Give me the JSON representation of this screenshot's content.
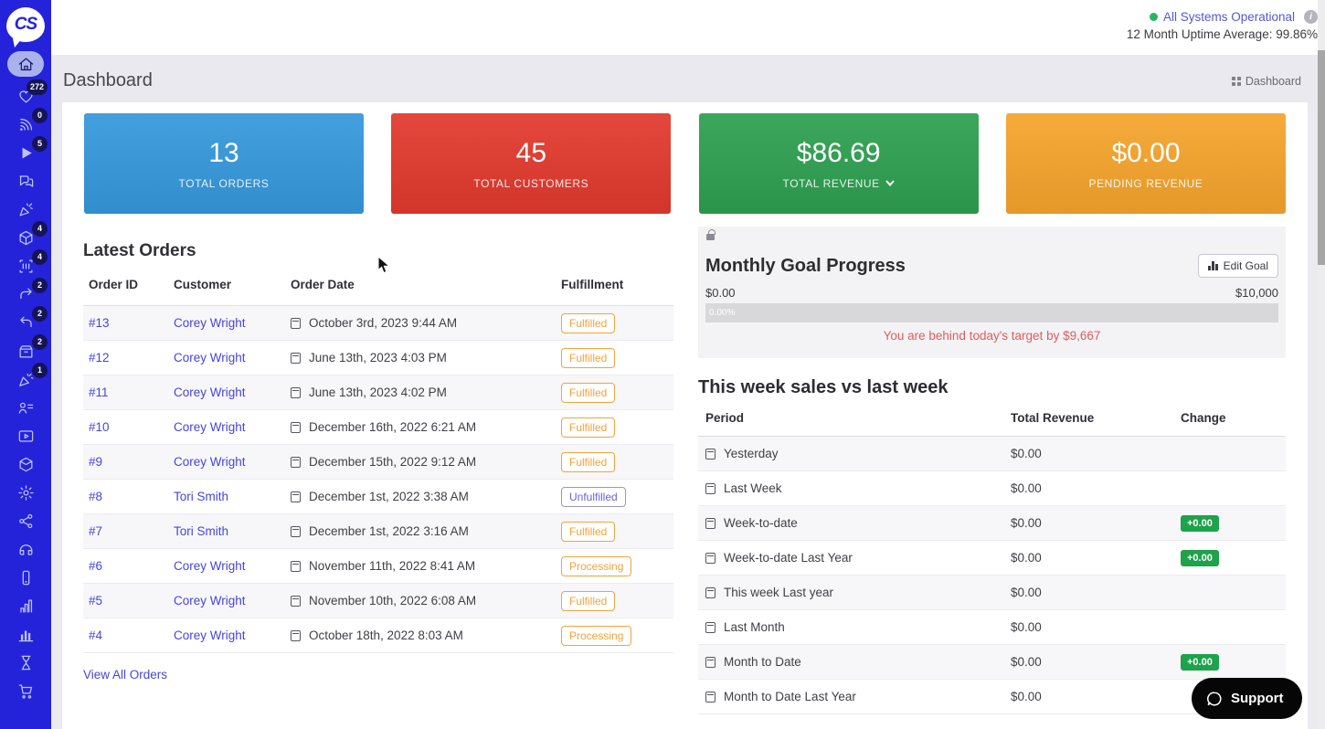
{
  "topbar": {
    "status_label": "All Systems Operational",
    "uptime_label": "12 Month Uptime Average: 99.86%",
    "info_glyph": "i"
  },
  "header": {
    "title": "Dashboard",
    "breadcrumb": "Dashboard"
  },
  "sidebar": {
    "logo": "CS",
    "items": [
      {
        "name": "dashboard-home",
        "badge": null
      },
      {
        "name": "favorites",
        "badge": "272"
      },
      {
        "name": "live-broadcast",
        "badge": "0"
      },
      {
        "name": "media-play",
        "badge": "5"
      },
      {
        "name": "messages",
        "badge": null
      },
      {
        "name": "promotions",
        "badge": null
      },
      {
        "name": "products",
        "badge": "4"
      },
      {
        "name": "inventory-scan",
        "badge": "4"
      },
      {
        "name": "orders-forward",
        "badge": "2"
      },
      {
        "name": "returns",
        "badge": "2"
      },
      {
        "name": "archive-box",
        "badge": "2"
      },
      {
        "name": "announcements",
        "badge": "1"
      },
      {
        "name": "customers",
        "badge": null
      },
      {
        "name": "video-library",
        "badge": null
      },
      {
        "name": "packages",
        "badge": null
      },
      {
        "name": "settings",
        "badge": null
      },
      {
        "name": "integrations",
        "badge": null
      },
      {
        "name": "support-headset",
        "badge": null
      },
      {
        "name": "mobile",
        "badge": null
      },
      {
        "name": "analytics",
        "badge": null
      },
      {
        "name": "reports",
        "badge": null
      },
      {
        "name": "history",
        "badge": null
      },
      {
        "name": "cart",
        "badge": null
      }
    ]
  },
  "stat_cards": [
    {
      "value": "13",
      "label": "TOTAL ORDERS",
      "color": "#3598db"
    },
    {
      "value": "45",
      "label": "TOTAL CUSTOMERS",
      "color": "#e2392d"
    },
    {
      "value": "$86.69",
      "label": "TOTAL REVENUE",
      "color": "#2da050"
    },
    {
      "value": "$0.00",
      "label": "PENDING REVENUE",
      "color": "#f5a42c"
    }
  ],
  "latest_orders": {
    "title": "Latest Orders",
    "columns": {
      "id": "Order ID",
      "customer": "Customer",
      "date": "Order Date",
      "fulfillment": "Fulfillment"
    },
    "rows": [
      {
        "id": "#13",
        "customer": "Corey Wright",
        "date": "October 3rd, 2023 9:44 AM",
        "status": "Fulfilled"
      },
      {
        "id": "#12",
        "customer": "Corey Wright",
        "date": "June 13th, 2023 4:03 PM",
        "status": "Fulfilled"
      },
      {
        "id": "#11",
        "customer": "Corey Wright",
        "date": "June 13th, 2023 4:02 PM",
        "status": "Fulfilled"
      },
      {
        "id": "#10",
        "customer": "Corey Wright",
        "date": "December 16th, 2022 6:21 AM",
        "status": "Fulfilled"
      },
      {
        "id": "#9",
        "customer": "Corey Wright",
        "date": "December 15th, 2022 9:12 AM",
        "status": "Fulfilled"
      },
      {
        "id": "#8",
        "customer": "Tori Smith",
        "date": "December 1st, 2022 3:38 AM",
        "status": "Unfulfilled"
      },
      {
        "id": "#7",
        "customer": "Tori Smith",
        "date": "December 1st, 2022 3:16 AM",
        "status": "Fulfilled"
      },
      {
        "id": "#6",
        "customer": "Corey Wright",
        "date": "November 11th, 2022 8:41 AM",
        "status": "Processing"
      },
      {
        "id": "#5",
        "customer": "Corey Wright",
        "date": "November 10th, 2022 6:08 AM",
        "status": "Fulfilled"
      },
      {
        "id": "#4",
        "customer": "Corey Wright",
        "date": "October 18th, 2022 8:03 AM",
        "status": "Processing"
      }
    ],
    "view_all_label": "View All Orders"
  },
  "goal": {
    "title": "Monthly Goal Progress",
    "edit_button": "Edit Goal",
    "min_label": "$0.00",
    "max_label": "$10,000",
    "progress_label": "0.00%",
    "behind_message": "You are behind today's target by $9,667"
  },
  "weekly_sales": {
    "title": "This week sales vs last week",
    "columns": {
      "period": "Period",
      "revenue": "Total Revenue",
      "change": "Change"
    },
    "rows": [
      {
        "period": "Yesterday",
        "revenue": "$0.00",
        "change": null
      },
      {
        "period": "Last Week",
        "revenue": "$0.00",
        "change": null
      },
      {
        "period": "Week-to-date",
        "revenue": "$0.00",
        "change": "+0.00"
      },
      {
        "period": "Week-to-date Last Year",
        "revenue": "$0.00",
        "change": "+0.00"
      },
      {
        "period": "This week Last year",
        "revenue": "$0.00",
        "change": null
      },
      {
        "period": "Last Month",
        "revenue": "$0.00",
        "change": null
      },
      {
        "period": "Month to Date",
        "revenue": "$0.00",
        "change": "+0.00"
      },
      {
        "period": "Month to Date Last Year",
        "revenue": "$0.00",
        "change": null
      }
    ]
  },
  "support": {
    "label": "Support"
  },
  "colors": {
    "sidebar_blue": "#2423da",
    "status_green": "#27b561",
    "fulfilled_orange": "#f2a33c",
    "change_green": "#1ea24b"
  }
}
